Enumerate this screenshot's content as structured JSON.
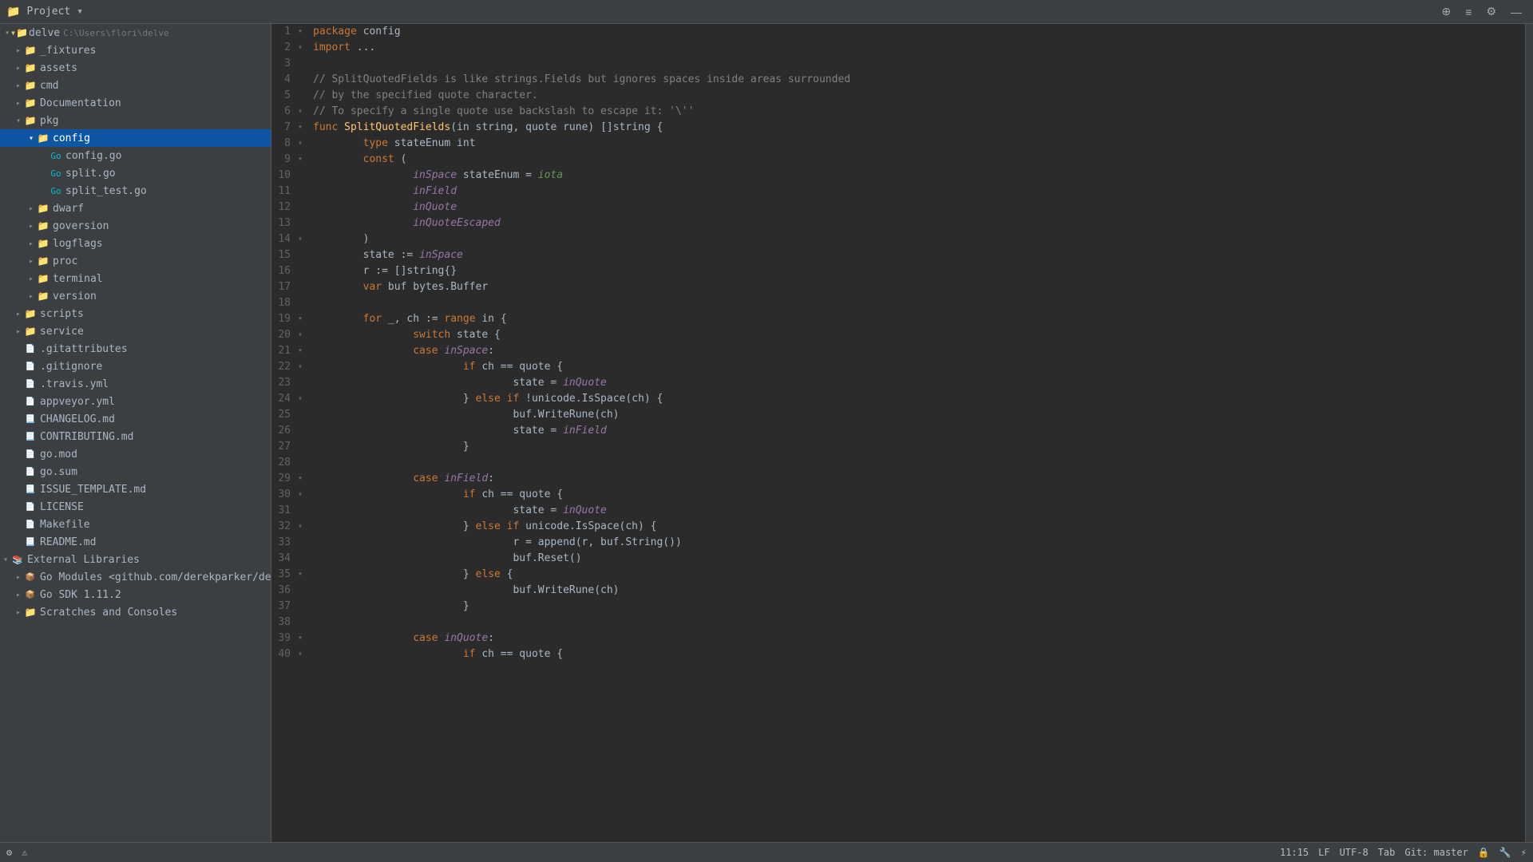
{
  "titleBar": {
    "icon": "📁",
    "title": "Project",
    "controls": [
      "⊕",
      "≡",
      "⚙",
      "—"
    ]
  },
  "sidebar": {
    "rootLabel": "delve",
    "rootPath": "C:\\Users\\flori\\delve",
    "items": [
      {
        "id": "fixtures",
        "label": "_fixtures",
        "type": "folder",
        "depth": 1,
        "open": false
      },
      {
        "id": "assets",
        "label": "assets",
        "type": "folder",
        "depth": 1,
        "open": false
      },
      {
        "id": "cmd",
        "label": "cmd",
        "type": "folder",
        "depth": 1,
        "open": false
      },
      {
        "id": "documentation",
        "label": "Documentation",
        "type": "folder",
        "depth": 1,
        "open": false
      },
      {
        "id": "pkg",
        "label": "pkg",
        "type": "folder",
        "depth": 1,
        "open": true
      },
      {
        "id": "config",
        "label": "config",
        "type": "folder",
        "depth": 2,
        "open": true,
        "selected": true
      },
      {
        "id": "config_go",
        "label": "config.go",
        "type": "go",
        "depth": 3
      },
      {
        "id": "split_go",
        "label": "split.go",
        "type": "go",
        "depth": 3
      },
      {
        "id": "split_test_go",
        "label": "split_test.go",
        "type": "go",
        "depth": 3
      },
      {
        "id": "dwarf",
        "label": "dwarf",
        "type": "folder",
        "depth": 2,
        "open": false
      },
      {
        "id": "goversion",
        "label": "goversion",
        "type": "folder",
        "depth": 2,
        "open": false
      },
      {
        "id": "logflags",
        "label": "logflags",
        "type": "folder",
        "depth": 2,
        "open": false
      },
      {
        "id": "proc",
        "label": "proc",
        "type": "folder",
        "depth": 2,
        "open": false
      },
      {
        "id": "terminal",
        "label": "terminal",
        "type": "folder",
        "depth": 2,
        "open": false
      },
      {
        "id": "version",
        "label": "version",
        "type": "folder",
        "depth": 2,
        "open": false
      },
      {
        "id": "scripts",
        "label": "scripts",
        "type": "folder",
        "depth": 1,
        "open": false
      },
      {
        "id": "service",
        "label": "service",
        "type": "folder",
        "depth": 1,
        "open": false
      },
      {
        "id": "gitattributes",
        "label": ".gitattributes",
        "type": "file",
        "depth": 1
      },
      {
        "id": "gitignore",
        "label": ".gitignore",
        "type": "file",
        "depth": 1
      },
      {
        "id": "travis_yml",
        "label": ".travis.yml",
        "type": "yaml",
        "depth": 1
      },
      {
        "id": "appveyor_yml",
        "label": "appveyor.yml",
        "type": "yaml",
        "depth": 1
      },
      {
        "id": "changelog_md",
        "label": "CHANGELOG.md",
        "type": "md",
        "depth": 1
      },
      {
        "id": "contributing_md",
        "label": "CONTRIBUTING.md",
        "type": "md",
        "depth": 1
      },
      {
        "id": "go_mod",
        "label": "go.mod",
        "type": "mod",
        "depth": 1
      },
      {
        "id": "go_sum",
        "label": "go.sum",
        "type": "mod",
        "depth": 1
      },
      {
        "id": "issue_template_md",
        "label": "ISSUE_TEMPLATE.md",
        "type": "md",
        "depth": 1
      },
      {
        "id": "license",
        "label": "LICENSE",
        "type": "file",
        "depth": 1
      },
      {
        "id": "makefile",
        "label": "Makefile",
        "type": "file",
        "depth": 1
      },
      {
        "id": "readme_md",
        "label": "README.md",
        "type": "md",
        "depth": 1
      }
    ],
    "externalLibraries": "External Libraries",
    "externalItems": [
      {
        "id": "go_modules",
        "label": "Go Modules <github.com/derekparker/delve>",
        "type": "module",
        "depth": 1,
        "open": false
      },
      {
        "id": "go_sdk",
        "label": "Go SDK 1.11.2",
        "type": "sdk",
        "depth": 1,
        "open": false
      },
      {
        "id": "scratches",
        "label": "Scratches and Consoles",
        "type": "folder",
        "depth": 1,
        "open": false
      }
    ]
  },
  "editor": {
    "filename": "split.go",
    "packageName": "config",
    "code_lines": [
      {
        "num": 1,
        "fold": "▾",
        "tokens": [
          {
            "t": "package ",
            "c": "kw"
          },
          {
            "t": "config",
            "c": ""
          }
        ]
      },
      {
        "num": 2,
        "fold": "▾",
        "tokens": [
          {
            "t": "import ...",
            "c": "kw"
          }
        ]
      },
      {
        "num": 3,
        "fold": "",
        "tokens": []
      },
      {
        "num": 4,
        "fold": "",
        "tokens": [
          {
            "t": "// SplitQuotedFields is like strings.Fields but ignores spaces inside areas surrounded",
            "c": "comment"
          }
        ]
      },
      {
        "num": 5,
        "fold": "",
        "tokens": [
          {
            "t": "// by the specified quote character.",
            "c": "comment"
          }
        ]
      },
      {
        "num": 6,
        "fold": "▾",
        "tokens": [
          {
            "t": "// To specify a single quote use backslash to escape it: '\\''",
            "c": "comment"
          }
        ]
      },
      {
        "num": 7,
        "fold": "▾",
        "tokens": [
          {
            "t": "func ",
            "c": "kw"
          },
          {
            "t": "SplitQuotedFields",
            "c": "fn"
          },
          {
            "t": "(in ",
            "c": ""
          },
          {
            "t": "string",
            "c": "type"
          },
          {
            "t": ", quote ",
            "c": ""
          },
          {
            "t": "rune",
            "c": "type"
          },
          {
            "t": ") []",
            "c": ""
          },
          {
            "t": "string",
            "c": "type"
          },
          {
            "t": " {",
            "c": ""
          }
        ]
      },
      {
        "num": 8,
        "fold": "▾",
        "tokens": [
          {
            "t": "\ttype ",
            "c": "kw"
          },
          {
            "t": "stateEnum ",
            "c": ""
          },
          {
            "t": "int",
            "c": "type"
          }
        ]
      },
      {
        "num": 9,
        "fold": "▾",
        "tokens": [
          {
            "t": "\tconst",
            "c": "kw"
          },
          {
            "t": " (",
            "c": ""
          }
        ]
      },
      {
        "num": 10,
        "fold": "",
        "tokens": [
          {
            "t": "\t\t",
            "c": ""
          },
          {
            "t": "inSpace",
            "c": "var"
          },
          {
            "t": " stateEnum = ",
            "c": ""
          },
          {
            "t": "iota",
            "c": "italic"
          }
        ]
      },
      {
        "num": 11,
        "fold": "",
        "tokens": [
          {
            "t": "\t\t",
            "c": ""
          },
          {
            "t": "inField",
            "c": "var"
          }
        ]
      },
      {
        "num": 12,
        "fold": "",
        "tokens": [
          {
            "t": "\t\t",
            "c": ""
          },
          {
            "t": "inQuote",
            "c": "var"
          }
        ]
      },
      {
        "num": 13,
        "fold": "",
        "tokens": [
          {
            "t": "\t\t",
            "c": ""
          },
          {
            "t": "inQuoteEscaped",
            "c": "var"
          }
        ]
      },
      {
        "num": 14,
        "fold": "▾",
        "tokens": [
          {
            "t": "\t)",
            "c": ""
          }
        ]
      },
      {
        "num": 15,
        "fold": "",
        "tokens": [
          {
            "t": "\tstate := ",
            "c": ""
          },
          {
            "t": "inSpace",
            "c": "var"
          }
        ]
      },
      {
        "num": 16,
        "fold": "",
        "tokens": [
          {
            "t": "\tr := []",
            "c": ""
          },
          {
            "t": "string",
            "c": "type"
          },
          {
            "t": "{}",
            "c": ""
          }
        ]
      },
      {
        "num": 17,
        "fold": "",
        "tokens": [
          {
            "t": "\t",
            "c": ""
          },
          {
            "t": "var",
            "c": "kw"
          },
          {
            "t": " buf bytes.",
            "c": ""
          },
          {
            "t": "Buffer",
            "c": "type"
          }
        ]
      },
      {
        "num": 18,
        "fold": "",
        "tokens": []
      },
      {
        "num": 19,
        "fold": "▾",
        "tokens": [
          {
            "t": "\t",
            "c": ""
          },
          {
            "t": "for",
            "c": "kw"
          },
          {
            "t": " _, ch := ",
            "c": ""
          },
          {
            "t": "range",
            "c": "kw"
          },
          {
            "t": " in {",
            "c": ""
          }
        ]
      },
      {
        "num": 20,
        "fold": "▾",
        "tokens": [
          {
            "t": "\t\t",
            "c": ""
          },
          {
            "t": "switch",
            "c": "kw"
          },
          {
            "t": " state {",
            "c": ""
          }
        ]
      },
      {
        "num": 21,
        "fold": "▾",
        "tokens": [
          {
            "t": "\t\t",
            "c": ""
          },
          {
            "t": "case ",
            "c": "kw"
          },
          {
            "t": "inSpace",
            "c": "var"
          },
          {
            "t": ":",
            "c": ""
          }
        ]
      },
      {
        "num": 22,
        "fold": "▾",
        "tokens": [
          {
            "t": "\t\t\t",
            "c": ""
          },
          {
            "t": "if",
            "c": "kw"
          },
          {
            "t": " ch == quote {",
            "c": ""
          }
        ]
      },
      {
        "num": 23,
        "fold": "",
        "tokens": [
          {
            "t": "\t\t\t\tstate = ",
            "c": ""
          },
          {
            "t": "inQuote",
            "c": "var"
          }
        ]
      },
      {
        "num": 24,
        "fold": "▾",
        "tokens": [
          {
            "t": "\t\t\t} ",
            "c": ""
          },
          {
            "t": "else if",
            "c": "kw"
          },
          {
            "t": " !unicode.IsSpace(ch) {",
            "c": ""
          }
        ]
      },
      {
        "num": 25,
        "fold": "",
        "tokens": [
          {
            "t": "\t\t\t\tbuf.WriteRune(ch)",
            "c": ""
          }
        ]
      },
      {
        "num": 26,
        "fold": "",
        "tokens": [
          {
            "t": "\t\t\t\tstate = ",
            "c": ""
          },
          {
            "t": "inField",
            "c": "var"
          }
        ]
      },
      {
        "num": 27,
        "fold": "",
        "tokens": [
          {
            "t": "\t\t\t}",
            "c": ""
          }
        ]
      },
      {
        "num": 28,
        "fold": "",
        "tokens": []
      },
      {
        "num": 29,
        "fold": "▾",
        "tokens": [
          {
            "t": "\t\t",
            "c": ""
          },
          {
            "t": "case ",
            "c": "kw"
          },
          {
            "t": "inField",
            "c": "var"
          },
          {
            "t": ":",
            "c": ""
          }
        ]
      },
      {
        "num": 30,
        "fold": "▾",
        "tokens": [
          {
            "t": "\t\t\t",
            "c": ""
          },
          {
            "t": "if",
            "c": "kw"
          },
          {
            "t": " ch == quote {",
            "c": ""
          }
        ]
      },
      {
        "num": 31,
        "fold": "",
        "tokens": [
          {
            "t": "\t\t\t\tstate = ",
            "c": ""
          },
          {
            "t": "inQuote",
            "c": "var"
          }
        ]
      },
      {
        "num": 32,
        "fold": "▾",
        "tokens": [
          {
            "t": "\t\t\t} ",
            "c": ""
          },
          {
            "t": "else if",
            "c": "kw"
          },
          {
            "t": " unicode.IsSpace(ch) {",
            "c": ""
          }
        ]
      },
      {
        "num": 33,
        "fold": "",
        "tokens": [
          {
            "t": "\t\t\t\tr = append(r, buf.String())",
            "c": ""
          }
        ]
      },
      {
        "num": 34,
        "fold": "",
        "tokens": [
          {
            "t": "\t\t\t\tbuf.Reset()",
            "c": ""
          }
        ]
      },
      {
        "num": 35,
        "fold": "▾",
        "tokens": [
          {
            "t": "\t\t\t} ",
            "c": ""
          },
          {
            "t": "else",
            "c": "kw"
          },
          {
            "t": " {",
            "c": ""
          }
        ]
      },
      {
        "num": 36,
        "fold": "",
        "tokens": [
          {
            "t": "\t\t\t\tbuf.WriteRune(ch)",
            "c": ""
          }
        ]
      },
      {
        "num": 37,
        "fold": "",
        "tokens": [
          {
            "t": "\t\t\t}",
            "c": ""
          }
        ]
      },
      {
        "num": 38,
        "fold": "",
        "tokens": []
      },
      {
        "num": 39,
        "fold": "▾",
        "tokens": [
          {
            "t": "\t\t",
            "c": ""
          },
          {
            "t": "case ",
            "c": "kw"
          },
          {
            "t": "inQuote",
            "c": "var"
          },
          {
            "t": ":",
            "c": ""
          }
        ]
      },
      {
        "num": 40,
        "fold": "▾",
        "tokens": [
          {
            "t": "\t\t\t",
            "c": ""
          },
          {
            "t": "if",
            "c": "kw"
          },
          {
            "t": " ch == quote {",
            "c": ""
          }
        ]
      }
    ]
  },
  "statusBar": {
    "line": "11:15",
    "lineEnding": "LF",
    "encoding": "UTF-8",
    "indent": "Tab",
    "vcs": "Git: master",
    "icons": [
      "⚙",
      "🔒",
      "⚡"
    ]
  }
}
